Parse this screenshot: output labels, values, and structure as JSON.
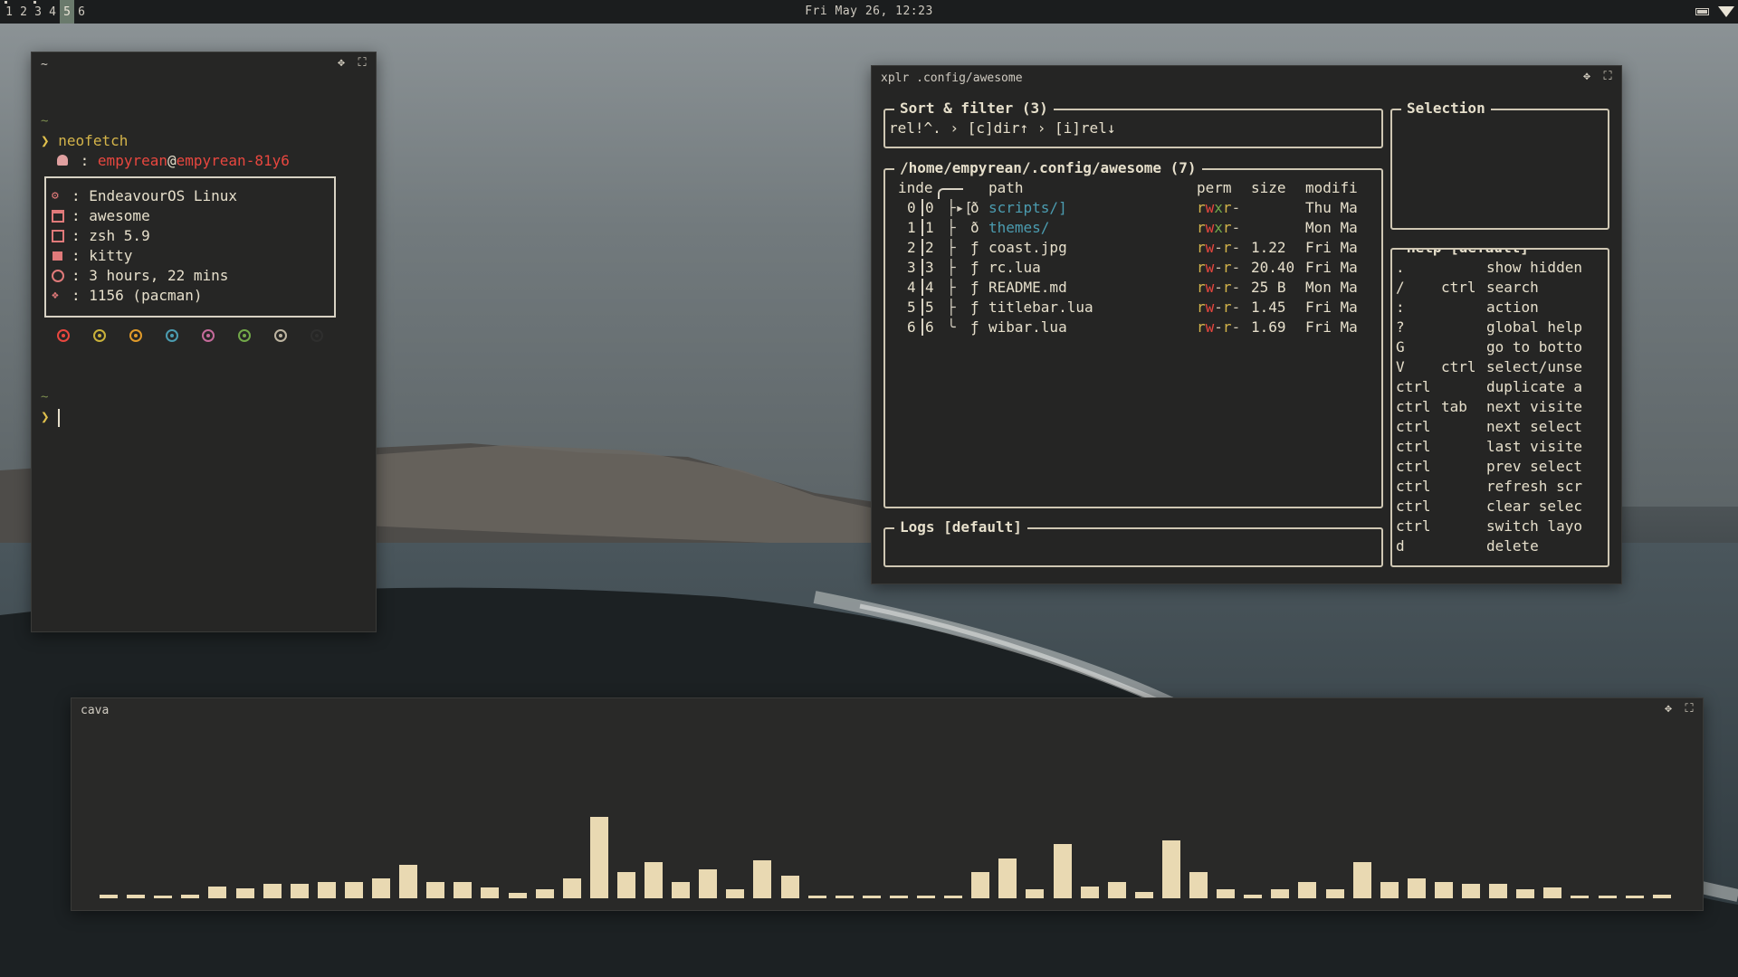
{
  "topbar": {
    "tags": [
      "1",
      "2",
      "3",
      "4",
      "5",
      "6"
    ],
    "active_tag": "5",
    "clock": "Fri May 26, 12:23"
  },
  "terminal": {
    "title": "~",
    "prompt_dir": "~",
    "prompt_symbol": "❯",
    "command": "neofetch",
    "user": "empyrean",
    "at": "@",
    "host": "empyrean-81y6",
    "info": [
      {
        "icon": "gear-icon",
        "text": ": EndeavourOS Linux"
      },
      {
        "icon": "window-icon",
        "text": ": awesome"
      },
      {
        "icon": "terminal-icon",
        "text": ": zsh 5.9"
      },
      {
        "icon": "cat-icon",
        "text": ": kitty"
      },
      {
        "icon": "clock-icon",
        "text": ": 3 hours, 22 mins"
      },
      {
        "icon": "package-icon",
        "text": ": 1156 (pacman)"
      }
    ],
    "user_sep": ":",
    "color_dots": [
      "#e8473f",
      "#c9b13a",
      "#e09a2a",
      "#4b9cb0",
      "#c46a9a",
      "#72a849",
      "#bdb4a0",
      "#2f2f2e"
    ]
  },
  "xplr": {
    "title": "xplr .config/awesome",
    "sort_filter": {
      "title": "Sort & filter (3)",
      "text": "rel!^. › [c]dir↑ › [i]rel↓"
    },
    "table": {
      "title": "/home/empyrean/.config/awesome (7)",
      "headers": {
        "index": "inde",
        "path": "path",
        "perm": "perm",
        "size": "size",
        "modified": "modifi"
      },
      "rows": [
        {
          "i1": "0",
          "i2": "0",
          "tree": "├▸[",
          "icon": "ð",
          "name": "scripts/]",
          "is_dir": true,
          "perm": "rwxr-",
          "size": "",
          "mod": "Thu Ma"
        },
        {
          "i1": "1",
          "i2": "1",
          "tree": "├",
          "icon": "ð",
          "name": "themes/",
          "is_dir": true,
          "perm": "rwxr-",
          "size": "",
          "mod": "Mon Ma"
        },
        {
          "i1": "2",
          "i2": "2",
          "tree": "├",
          "icon": "ƒ",
          "name": "coast.jpg",
          "is_dir": false,
          "perm": "rw-r-",
          "size": "1.22",
          "mod": "Fri Ma"
        },
        {
          "i1": "3",
          "i2": "3",
          "tree": "├",
          "icon": "ƒ",
          "name": "rc.lua",
          "is_dir": false,
          "perm": "rw-r-",
          "size": "20.40",
          "mod": "Fri Ma"
        },
        {
          "i1": "4",
          "i2": "4",
          "tree": "├",
          "icon": "ƒ",
          "name": "README.md",
          "is_dir": false,
          "perm": "rw-r-",
          "size": "25 B",
          "mod": "Mon Ma"
        },
        {
          "i1": "5",
          "i2": "5",
          "tree": "├",
          "icon": "ƒ",
          "name": "titlebar.lua",
          "is_dir": false,
          "perm": "rw-r-",
          "size": "1.45",
          "mod": "Fri Ma"
        },
        {
          "i1": "6",
          "i2": "6",
          "tree": "╰",
          "icon": "ƒ",
          "name": "wibar.lua",
          "is_dir": false,
          "perm": "rw-r-",
          "size": "1.69",
          "mod": "Fri Ma"
        }
      ]
    },
    "logs_title": "Logs [default]",
    "selection_title": "Selection",
    "help": {
      "title": "Help [default]",
      "rows": [
        {
          "k1": ".",
          "k2": "",
          "act": "show hidden"
        },
        {
          "k1": "/",
          "k2": "ctrl",
          "act": "search"
        },
        {
          "k1": ":",
          "k2": "",
          "act": "action"
        },
        {
          "k1": "?",
          "k2": "",
          "act": "global help"
        },
        {
          "k1": "G",
          "k2": "",
          "act": "go to botto"
        },
        {
          "k1": "V",
          "k2": "ctrl",
          "act": "select/unse"
        },
        {
          "k1": "ctrl",
          "k2": "",
          "act": "duplicate a"
        },
        {
          "k1": "ctrl",
          "k2": "tab",
          "act": "next visite"
        },
        {
          "k1": "ctrl",
          "k2": "",
          "act": "next select"
        },
        {
          "k1": "ctrl",
          "k2": "",
          "act": "last visite"
        },
        {
          "k1": "ctrl",
          "k2": "",
          "act": "prev select"
        },
        {
          "k1": "ctrl",
          "k2": "",
          "act": "refresh scr"
        },
        {
          "k1": "ctrl",
          "k2": "",
          "act": "clear selec"
        },
        {
          "k1": "ctrl",
          "k2": "",
          "act": "switch layo"
        },
        {
          "k1": "d",
          "k2": "",
          "act": "delete"
        }
      ]
    }
  },
  "cava": {
    "title": "cava",
    "bar_color": "#e9d9b2",
    "levels": [
      0.04,
      0.04,
      0.02,
      0.04,
      0.14,
      0.12,
      0.17,
      0.17,
      0.2,
      0.2,
      0.24,
      0.4,
      0.2,
      0.2,
      0.13,
      0.06,
      0.11,
      0.24,
      0.98,
      0.31,
      0.43,
      0.2,
      0.35,
      0.11,
      0.46,
      0.27,
      0.02,
      0.02,
      0.02,
      0.02,
      0.02,
      0.02,
      0.31,
      0.48,
      0.11,
      0.65,
      0.14,
      0.2,
      0.08,
      0.7,
      0.31,
      0.11,
      0.04,
      0.11,
      0.2,
      0.11,
      0.44,
      0.2,
      0.24,
      0.2,
      0.17,
      0.17,
      0.11,
      0.13,
      0.02,
      0.02,
      0.02,
      0.04
    ]
  }
}
